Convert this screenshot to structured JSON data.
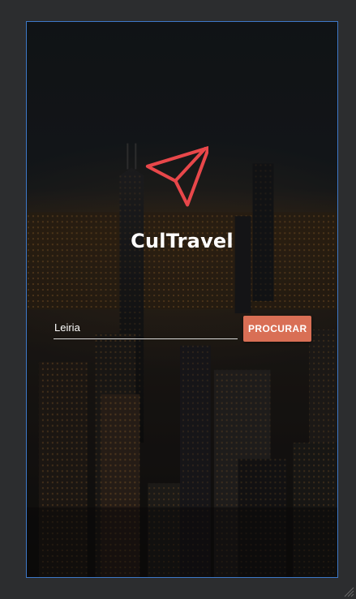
{
  "app": {
    "brand_name": "CulTravel",
    "logo_icon": "paper-plane-icon",
    "accent_color": "#e8474a",
    "button_color": "#d96f55"
  },
  "search": {
    "city_value": "Leiria",
    "button_label": "PROCURAR"
  },
  "editor": {
    "resize_handle_icon": "resize-grip-icon"
  }
}
